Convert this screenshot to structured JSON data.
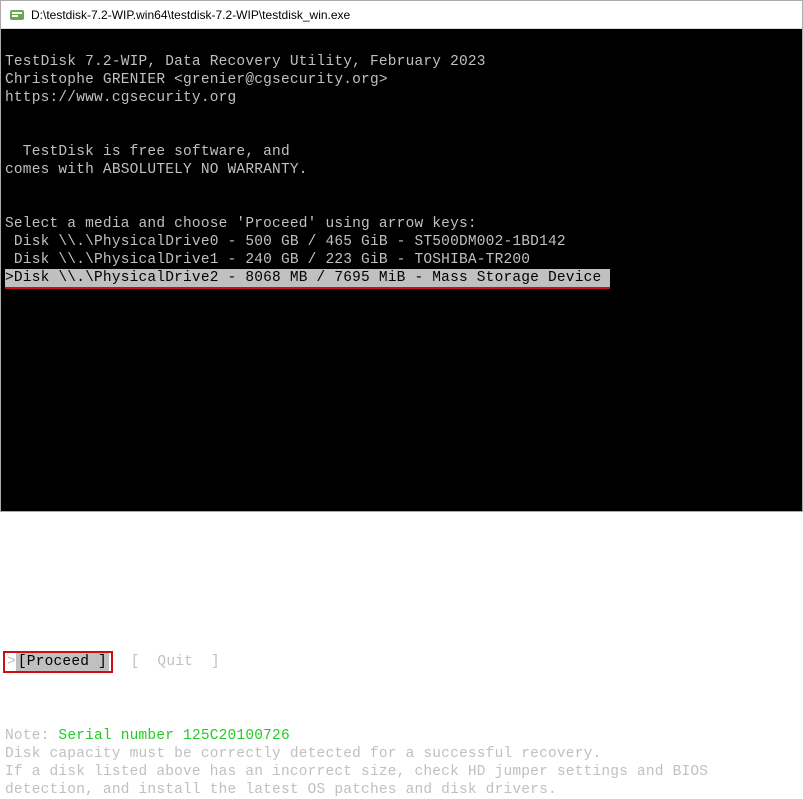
{
  "titlebar": {
    "path": "D:\\testdisk-7.2-WIP.win64\\testdisk-7.2-WIP\\testdisk_win.exe"
  },
  "header": {
    "line1": "TestDisk 7.2-WIP, Data Recovery Utility, February 2023",
    "line2": "Christophe GRENIER <grenier@cgsecurity.org>",
    "line3": "https://www.cgsecurity.org"
  },
  "info": {
    "free1": "  TestDisk is free software, and",
    "free2": "comes with ABSOLUTELY NO WARRANTY."
  },
  "prompt": "Select a media and choose 'Proceed' using arrow keys:",
  "disks": [
    {
      "text": " Disk \\\\.\\PhysicalDrive0 - 500 GB / 465 GiB - ST500DM002-1BD142",
      "selected": false
    },
    {
      "text": " Disk \\\\.\\PhysicalDrive1 - 240 GB / 223 GiB - TOSHIBA-TR200",
      "selected": false
    },
    {
      "text": ">Disk \\\\.\\PhysicalDrive2 - 8068 MB / 7695 MiB - Mass Storage Device ",
      "selected": true
    }
  ],
  "actions": {
    "selected_label": "[Proceed ]",
    "cursor": ">",
    "other": "  [  Quit  ]"
  },
  "note": {
    "label": "Note: ",
    "serial": "Serial number 125C20100726",
    "line1": "Disk capacity must be correctly detected for a successful recovery.",
    "line2": "If a disk listed above has an incorrect size, check HD jumper settings and BIOS",
    "line3": "detection, and install the latest OS patches and disk drivers."
  }
}
